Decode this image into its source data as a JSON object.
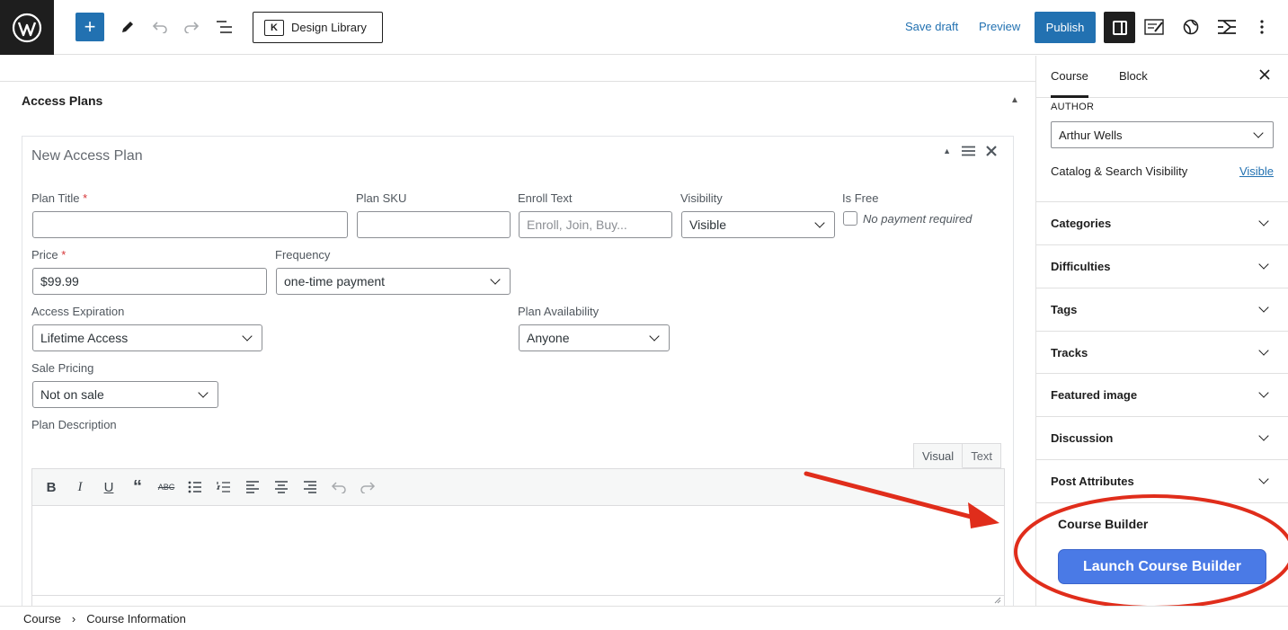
{
  "toolbar": {
    "design_library_label": "Design Library",
    "save_draft_label": "Save draft",
    "preview_label": "Preview",
    "publish_label": "Publish",
    "icons": [
      "wordpress-logo",
      "add-block-icon",
      "pen-icon",
      "undo-icon",
      "redo-icon",
      "list-view-icon",
      "settings-icon",
      "block-icon",
      "theme-icon",
      "plugin-icon",
      "options-icon"
    ]
  },
  "main": {
    "section_title": "Access Plans",
    "plan": {
      "header": "New Access Plan",
      "fields": {
        "plan_title_label": "Plan Title",
        "plan_title_value": "",
        "plan_sku_label": "Plan SKU",
        "plan_sku_value": "",
        "enroll_text_label": "Enroll Text",
        "enroll_text_placeholder": "Enroll, Join, Buy...",
        "visibility_label": "Visibility",
        "visibility_value": "Visible",
        "is_free_label": "Is Free",
        "is_free_checkbox_label": "No payment required",
        "price_label": "Price",
        "price_value": "$99.99",
        "frequency_label": "Frequency",
        "frequency_value": "one-time payment",
        "access_expiration_label": "Access Expiration",
        "access_expiration_value": "Lifetime Access",
        "plan_availability_label": "Plan Availability",
        "plan_availability_value": "Anyone",
        "sale_pricing_label": "Sale Pricing",
        "sale_pricing_value": "Not on sale",
        "plan_description_label": "Plan Description",
        "required_mark": "*"
      },
      "editor_tabs": [
        "Visual",
        "Text"
      ]
    }
  },
  "sidebar": {
    "tabs": [
      "Course",
      "Block"
    ],
    "author_label": "AUTHOR",
    "author_value": "Arthur Wells",
    "visibility_label": "Catalog & Search Visibility",
    "visibility_value": "Visible",
    "panels": [
      "Categories",
      "Difficulties",
      "Tags",
      "Tracks",
      "Featured image",
      "Discussion",
      "Post Attributes"
    ],
    "course_builder_title": "Course Builder",
    "launch_button_label": "Launch Course Builder"
  },
  "footer": {
    "breadcrumb": [
      "Course",
      "Course Information"
    ],
    "separator": "›"
  },
  "colors": {
    "accent": "#2271b1",
    "launch_button": "#4a7ae6",
    "annotation": "#e02d1b"
  }
}
